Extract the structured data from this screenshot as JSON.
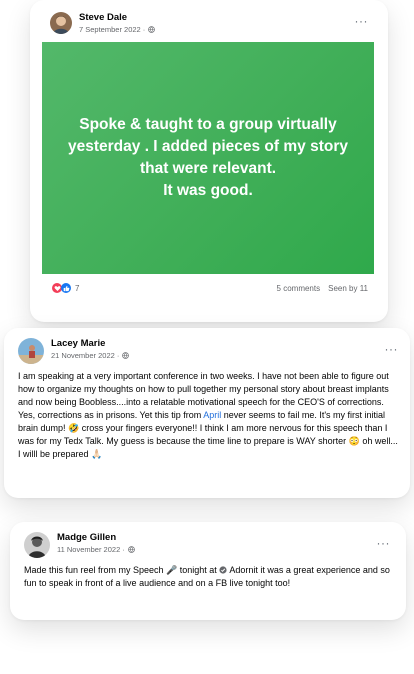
{
  "colors": {
    "green_post": "#3fae57",
    "link": "#216fdb",
    "meta": "#65676b",
    "love": "#f33e58",
    "like": "#1877f2"
  },
  "posts": [
    {
      "author": "Steve Dale",
      "date": "7 September 2022 ·",
      "privacy_icon": "globe-icon",
      "text_lines": [
        "Spoke & taught to a group virtually",
        "yesterday . I added pieces of my story",
        "that were relevant.",
        "It was good."
      ],
      "reactions": {
        "icons": [
          "love-icon",
          "like-icon"
        ],
        "count": "7"
      },
      "comments": "5 comments",
      "seen_by": "Seen by 11"
    },
    {
      "author": "Lacey Marie",
      "date": "21 November 2022 ·",
      "privacy_icon": "globe-icon",
      "text_before_link": "I am speaking at a very important conference in two weeks. I have not been able to figure out how to organize my thoughts on how to pull together my personal story about breast implants and now being Boobless....into a relatable motivational speech for the CEO'S of corrections. Yes, corrections as in prisons. Yet this tip from ",
      "link": "April",
      "text_after_link": " never seems to fail me. It's my first initial brain dump! 🤣 cross your fingers everyone!! I think I am more nervous for this speech than I was for my Tedx Talk. My guess is because the time line to prepare is WAY shorter 😳 oh well... I willl be prepared 🙏🏻"
    },
    {
      "author": "Madge Gillen",
      "date": "11 November 2022 ·",
      "privacy_icon": "globe-icon",
      "text_a": "Made this fun reel from my Speech 🎤 tonight at ",
      "mention": "Adornit",
      "text_b": " it was a great experience and so fun to speak in front of a live audience and on a FB live tonight too!"
    }
  ],
  "more_label": "···"
}
